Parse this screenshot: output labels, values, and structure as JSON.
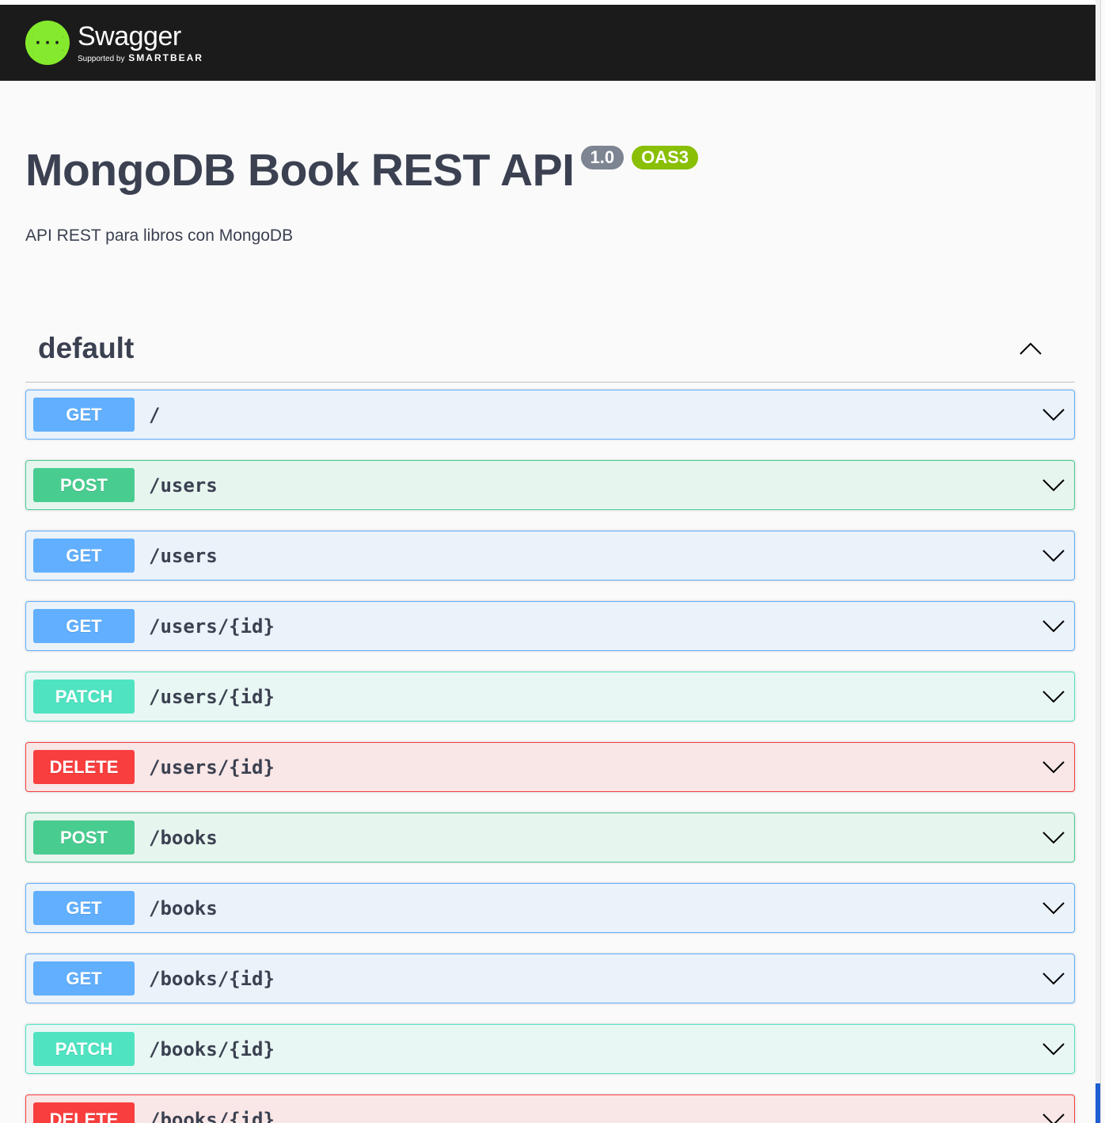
{
  "topbar": {
    "logo_title": "Swagger",
    "logo_supported": "Supported by",
    "logo_brand": "SMARTBEAR"
  },
  "info": {
    "title": "MongoDB Book REST API",
    "version": "1.0",
    "oas": "OAS3",
    "description": "API REST para libros con MongoDB"
  },
  "tag": {
    "name": "default"
  },
  "operations": [
    {
      "method": "GET",
      "path": "/"
    },
    {
      "method": "POST",
      "path": "/users"
    },
    {
      "method": "GET",
      "path": "/users"
    },
    {
      "method": "GET",
      "path": "/users/{id}"
    },
    {
      "method": "PATCH",
      "path": "/users/{id}"
    },
    {
      "method": "DELETE",
      "path": "/users/{id}"
    },
    {
      "method": "POST",
      "path": "/books"
    },
    {
      "method": "GET",
      "path": "/books"
    },
    {
      "method": "GET",
      "path": "/books/{id}"
    },
    {
      "method": "PATCH",
      "path": "/books/{id}"
    },
    {
      "method": "DELETE",
      "path": "/books/{id}"
    }
  ],
  "icons": {
    "logo": "swagger-logo-icon",
    "collapse": "chevron-up-icon",
    "expand": "chevron-down-icon"
  },
  "colors": {
    "GET": "#61affe",
    "POST": "#49cc90",
    "PATCH": "#50e3c2",
    "DELETE": "#f93e3e",
    "topbar": "#1b1b1b",
    "logo": "#85ea2d",
    "version_badge": "#7d8492",
    "oas_badge": "#89bf04"
  }
}
